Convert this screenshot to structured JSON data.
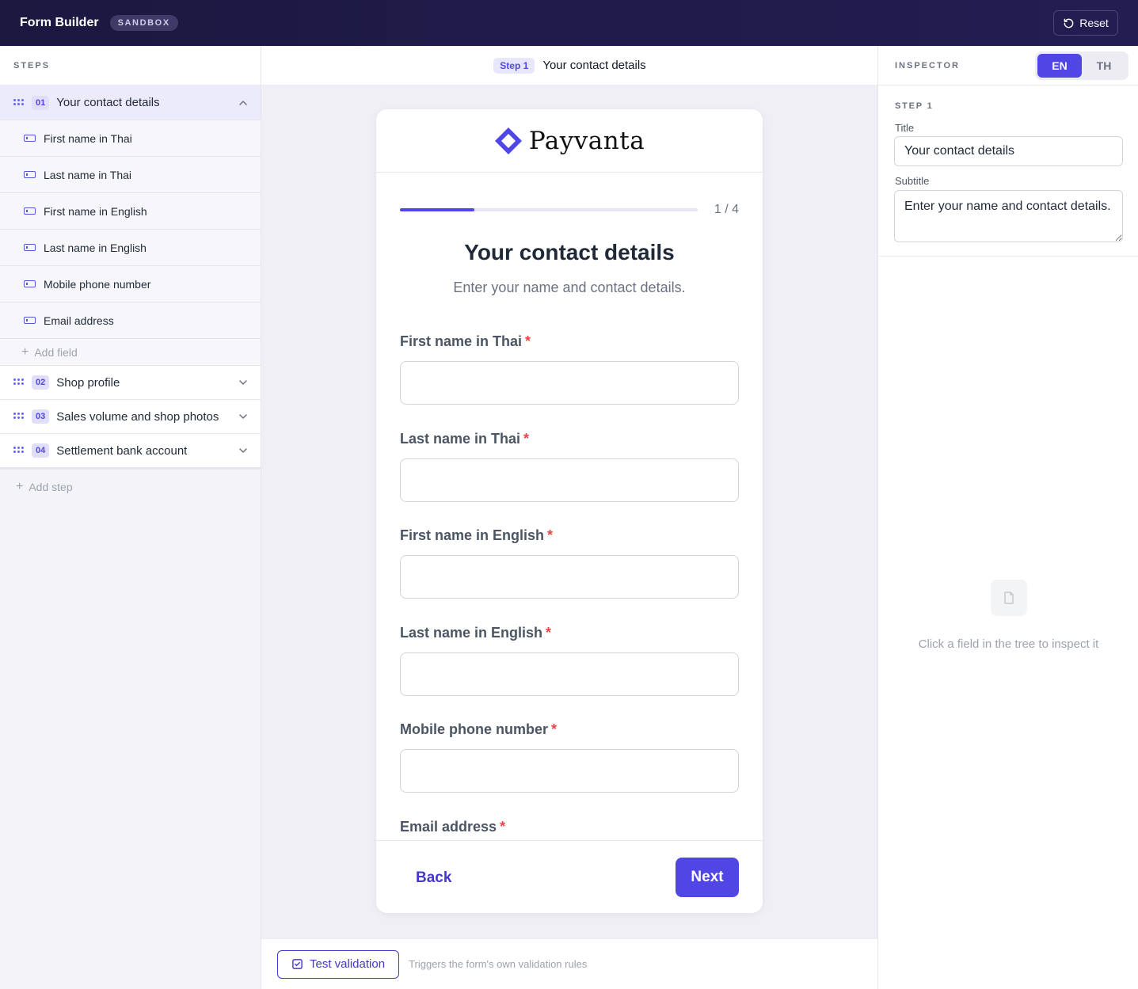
{
  "topbar": {
    "title": "Form Builder",
    "badge": "SANDBOX",
    "reset_label": "Reset"
  },
  "steps_panel": {
    "header": "STEPS",
    "steps": [
      {
        "number": "01",
        "label": "Your contact details",
        "expanded": true,
        "fields": [
          "First name in Thai",
          "Last name in Thai",
          "First name in English",
          "Last name in English",
          "Mobile phone number",
          "Email address"
        ],
        "add_field_label": "Add field"
      },
      {
        "number": "02",
        "label": "Shop profile",
        "expanded": false
      },
      {
        "number": "03",
        "label": "Sales volume and shop photos",
        "expanded": false
      },
      {
        "number": "04",
        "label": "Settlement bank account",
        "expanded": false
      }
    ],
    "add_step_label": "Add step"
  },
  "preview": {
    "step_pill": "Step 1",
    "step_title": "Your contact details",
    "brand_name": "Payvanta",
    "progress": {
      "current": 1,
      "total": 4,
      "text": "1 / 4"
    },
    "title": "Your contact details",
    "subtitle": "Enter your name and contact details.",
    "fields": [
      {
        "label": "First name in Thai",
        "required": "*",
        "value": ""
      },
      {
        "label": "Last name in Thai",
        "required": "*",
        "value": ""
      },
      {
        "label": "First name in English",
        "required": "*",
        "value": ""
      },
      {
        "label": "Last name in English",
        "required": "*",
        "value": ""
      },
      {
        "label": "Mobile phone number",
        "required": "*",
        "value": ""
      },
      {
        "label": "Email address",
        "required": "*",
        "value": ""
      }
    ],
    "back_label": "Back",
    "next_label": "Next",
    "test_validation_label": "Test validation",
    "test_validation_hint": "Triggers the form's own validation rules"
  },
  "inspector": {
    "header": "INSPECTOR",
    "languages": [
      "EN",
      "TH"
    ],
    "active_language": "EN",
    "section_label": "STEP 1",
    "title_label": "Title",
    "title_value": "Your contact details",
    "subtitle_label": "Subtitle",
    "subtitle_value": "Enter your name and contact details.",
    "empty_state": "Click a field in the tree to inspect it"
  },
  "colors": {
    "topbar": "#1c1840",
    "accent": "#5046e5",
    "required": "#ef4444"
  },
  "icons": [
    "reset-icon",
    "drag-handle-icon",
    "chevron-up-icon",
    "chevron-down-icon",
    "text-field-icon",
    "plus-icon",
    "diamond-logo-icon",
    "checkbox-icon",
    "document-icon"
  ]
}
